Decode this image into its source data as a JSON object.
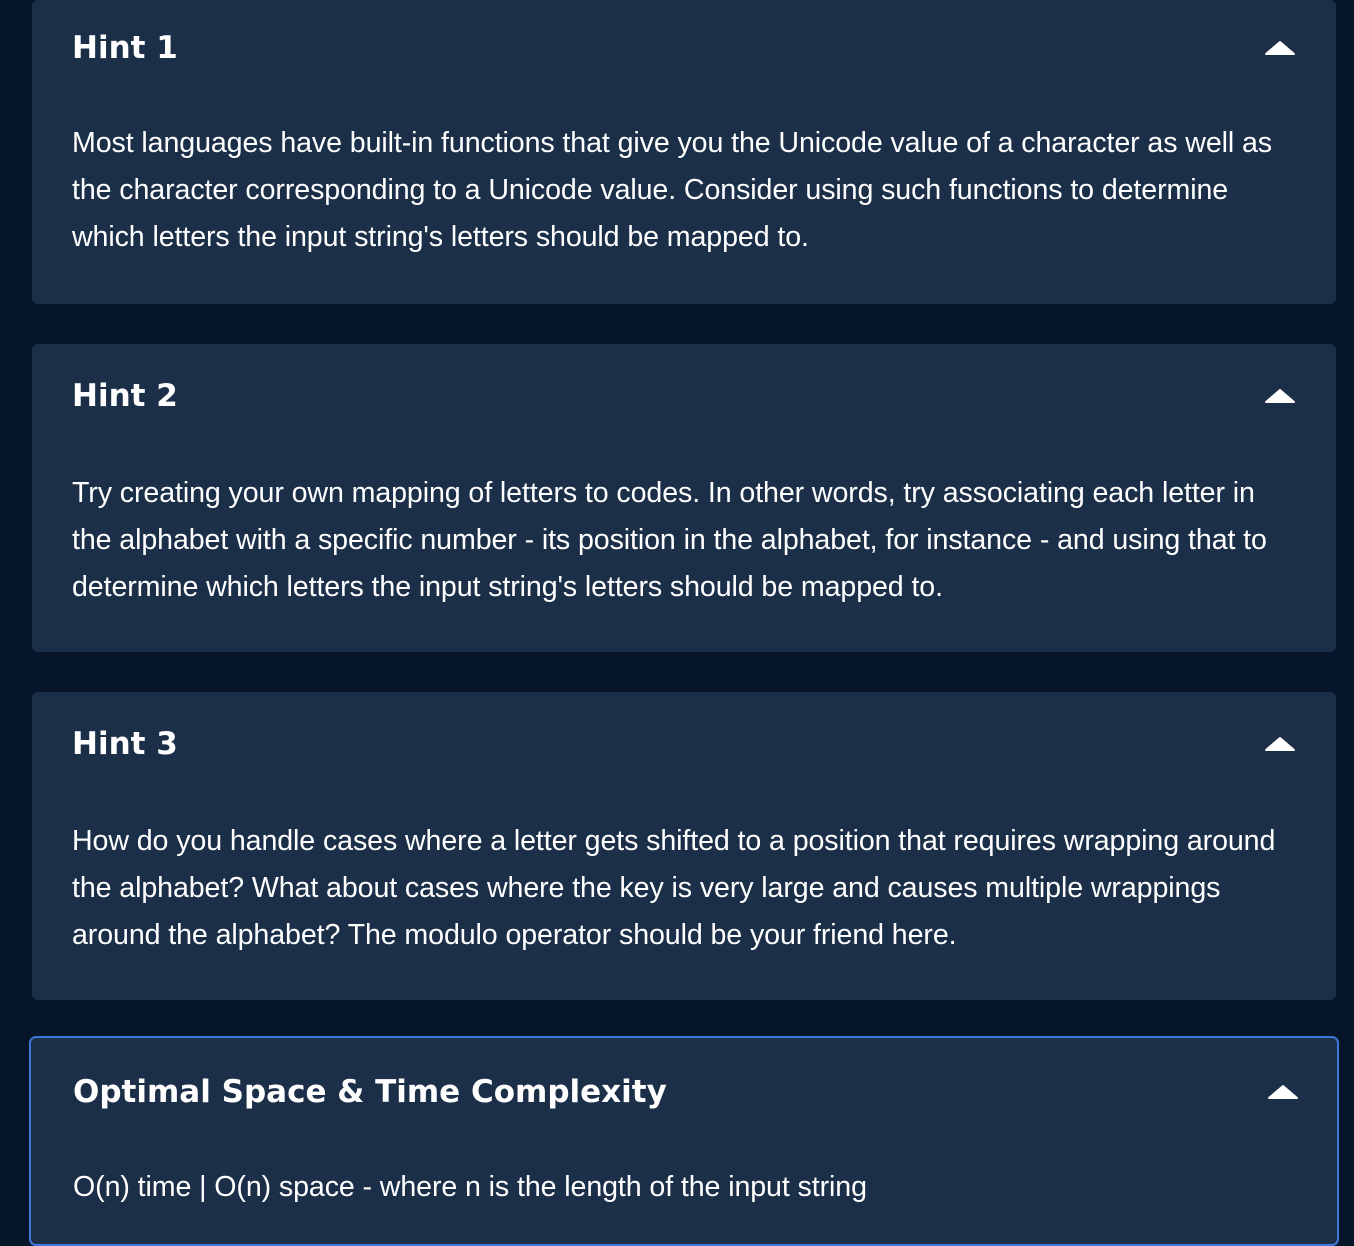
{
  "hints": [
    {
      "title": "Hint 1",
      "body": "Most languages have built-in functions that give you the Unicode value of a character as well as the character corresponding to a Unicode value. Consider using such functions to determine which letters the input string's letters should be mapped to."
    },
    {
      "title": "Hint 2",
      "body": "Try creating your own mapping of letters to codes. In other words, try associating each letter in the alphabet with a specific number - its position in the alphabet, for instance - and using that to determine which letters the input string's letters should be mapped to."
    },
    {
      "title": "Hint 3",
      "body": "How do you handle cases where a letter gets shifted to a position that requires wrapping around the alphabet? What about cases where the key is very large and causes multiple wrappings around the alphabet? The modulo operator should be your friend here."
    }
  ],
  "complexity": {
    "title": "Optimal Space & Time Complexity",
    "body": "O(n) time | O(n) space - where n is the length of the input string"
  },
  "icons": {
    "collapse": "chevron-up-icon"
  },
  "colors": {
    "background": "#06152a",
    "panel": "#1c2f48",
    "focus_border": "#3d78d8",
    "text": "#ffffff"
  }
}
